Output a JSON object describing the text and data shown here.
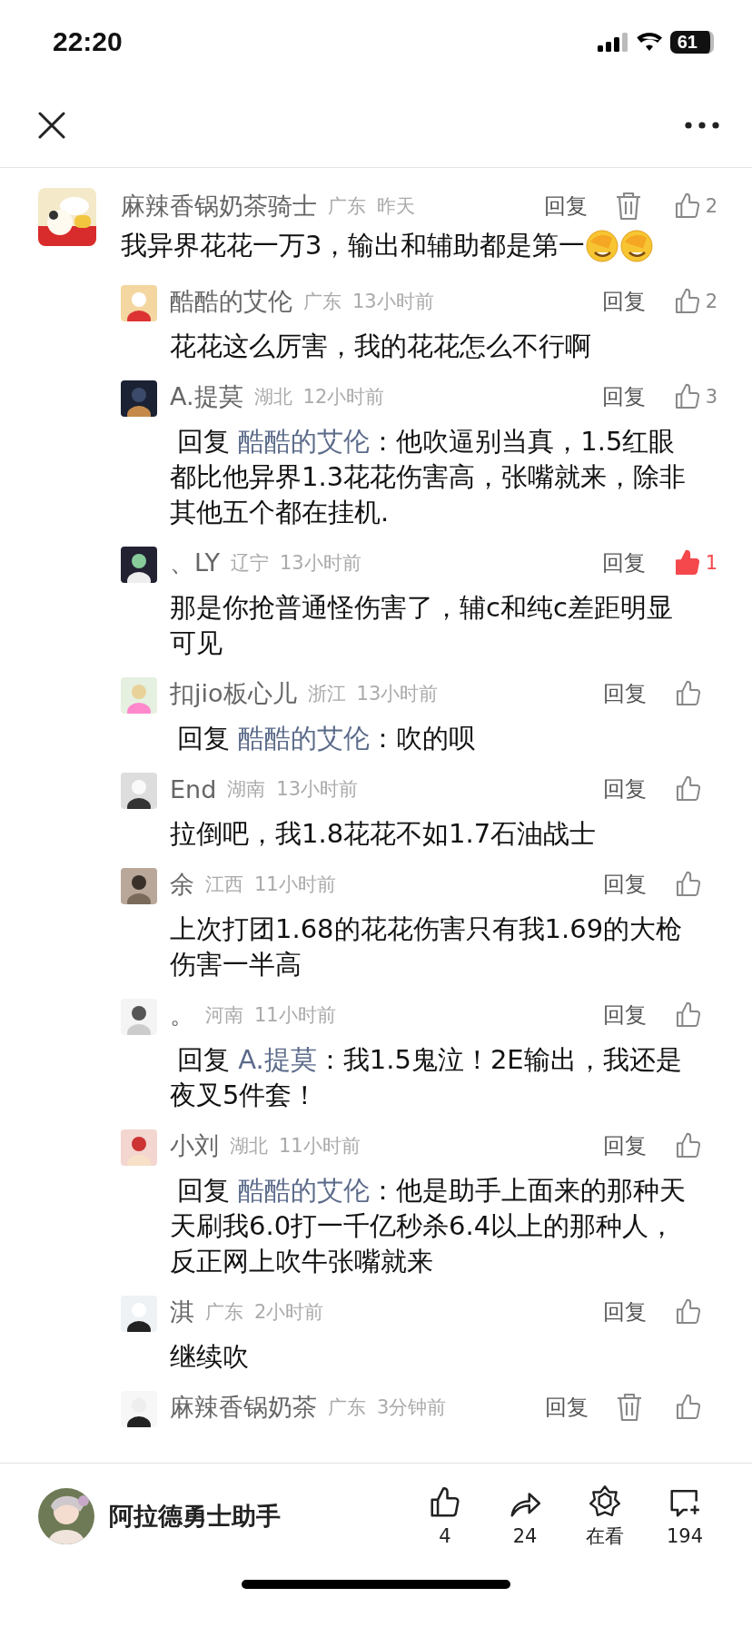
{
  "status_bar": {
    "time": "22:20",
    "battery": "61"
  },
  "comment": {
    "name": "麻辣香锅奶茶骑士",
    "region": "广东",
    "time": "昨天",
    "text": "我异界花花一万3，输出和辅助都是第一",
    "emojis": [
      {
        "kind": "facepalm"
      },
      {
        "kind": "facepalm"
      }
    ],
    "reply_label": "回复",
    "deletable": true,
    "likes": "2",
    "liked": false,
    "replies": [
      {
        "name": "酷酷的艾伦",
        "region": "广东",
        "time": "13小时前",
        "text": "花花这么厉害，我的花花怎么不行啊",
        "reply_label": "回复",
        "deletable": false,
        "likes": "2",
        "liked": false
      },
      {
        "name": "A.提莫",
        "region": "湖北",
        "time": "12小时前",
        "reply_prefix": "回复",
        "reply_to": "酷酷的艾伦",
        "text": "：他吹逼别当真，1.5红眼都比他异界1.3花花伤害高，张嘴就来，除非其他五个都在挂机.",
        "reply_label": "回复",
        "deletable": false,
        "likes": "3",
        "liked": false
      },
      {
        "name": "、LY",
        "region": "辽宁",
        "time": "13小时前",
        "text": "那是你抢普通怪伤害了，辅c和纯c差距明显可见",
        "reply_label": "回复",
        "deletable": false,
        "likes": "1",
        "liked": true
      },
      {
        "name": "扣jio板心儿",
        "region": "浙江",
        "time": "13小时前",
        "reply_prefix": "回复",
        "reply_to": "酷酷的艾伦",
        "text": "：吹的呗",
        "reply_label": "回复",
        "deletable": false,
        "liked": false
      },
      {
        "name": "End",
        "region": "湖南",
        "time": "13小时前",
        "text": "拉倒吧，我1.8花花不如1.7石油战士",
        "reply_label": "回复",
        "deletable": false,
        "liked": false
      },
      {
        "name": "余",
        "region": "江西",
        "time": "11小时前",
        "text": "上次打团1.68的花花伤害只有我1.69的大枪伤害一半高",
        "reply_label": "回复",
        "deletable": false,
        "liked": false
      },
      {
        "name": "。",
        "region": "河南",
        "time": "11小时前",
        "reply_prefix": "回复",
        "reply_to": "A.提莫",
        "text": "：我1.5鬼泣！2E输出，我还是夜叉5件套！",
        "reply_label": "回复",
        "deletable": false,
        "liked": false
      },
      {
        "name": "小刘",
        "region": "湖北",
        "time": "11小时前",
        "reply_prefix": "回复",
        "reply_to": "酷酷的艾伦",
        "text": "：他是助手上面来的那种天天刷我6.0打一千亿秒杀6.4以上的那种人，反正网上吹牛张嘴就来",
        "reply_label": "回复",
        "deletable": false,
        "liked": false
      },
      {
        "name": "淇",
        "region": "广东",
        "time": "2小时前",
        "text": "继续吹",
        "reply_label": "回复",
        "deletable": false,
        "liked": false
      },
      {
        "name": "麻辣香锅奶茶",
        "region": "广东",
        "time": "3分钟前",
        "reply_label": "回复",
        "deletable": true,
        "liked": false
      }
    ]
  },
  "footer": {
    "account": "阿拉德勇士助手",
    "actions": [
      {
        "kind": "like",
        "label": "4"
      },
      {
        "kind": "share",
        "label": "24"
      },
      {
        "kind": "watching",
        "label": "在看"
      },
      {
        "kind": "comment",
        "label": "194"
      }
    ]
  }
}
